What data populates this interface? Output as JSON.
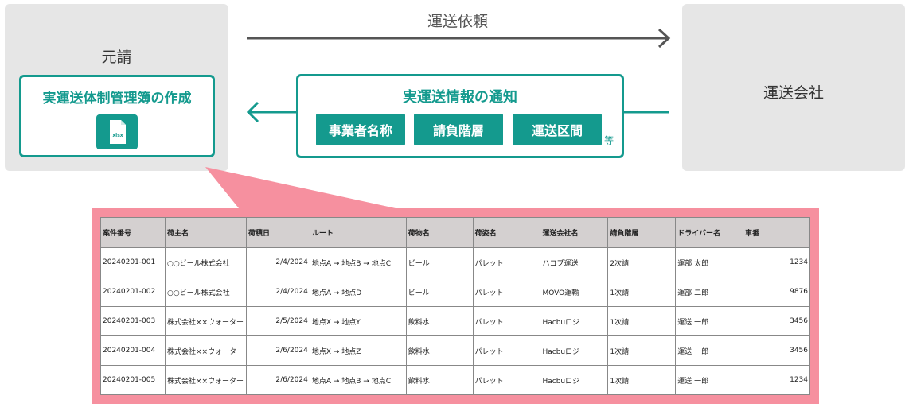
{
  "diagram": {
    "shipper_label": "元請",
    "carrier_label": "運送会社",
    "request_label": "運送依頼",
    "ledger_title": "実運送体制管理簿の作成",
    "file_icon_label": "xlsx",
    "notice_title": "実運送情報の通知",
    "notice_items": [
      "事業者名称",
      "請負階層",
      "運送区間"
    ],
    "notice_etc": "等",
    "colors": {
      "teal": "#149a8e",
      "gray_box": "#e6e6e6",
      "pink": "#f6909f",
      "arrow": "#555555"
    }
  },
  "table": {
    "headers": [
      "案件番号",
      "荷主名",
      "荷積日",
      "ルート",
      "荷物名",
      "荷姿名",
      "運送会社名",
      "請負階層",
      "ドライバー名",
      "車番"
    ],
    "rows": [
      [
        "20240201-001",
        "○○ビール株式会社",
        "2/4/2024",
        "地点A → 地点B → 地点C",
        "ビール",
        "パレット",
        "ハコブ運送",
        "2次請",
        "運部 太郎",
        "1234"
      ],
      [
        "20240201-002",
        "○○ビール株式会社",
        "2/4/2024",
        "地点A → 地点D",
        "ビール",
        "パレット",
        "MOVO運輸",
        "1次請",
        "運部 二郎",
        "9876"
      ],
      [
        "20240201-003",
        "株式会社××ウォーター",
        "2/5/2024",
        "地点X → 地点Y",
        "飲料水",
        "パレット",
        "Hacbuロジ",
        "1次請",
        "運送 一郎",
        "3456"
      ],
      [
        "20240201-004",
        "株式会社××ウォーター",
        "2/6/2024",
        "地点X → 地点Z",
        "飲料水",
        "パレット",
        "Hacbuロジ",
        "1次請",
        "運送 一郎",
        "3456"
      ],
      [
        "20240201-005",
        "株式会社××ウォーター",
        "2/6/2024",
        "地点A → 地点B → 地点C",
        "飲料水",
        "パレット",
        "Hacbuロジ",
        "1次請",
        "運送 一郎",
        "1234"
      ]
    ]
  }
}
